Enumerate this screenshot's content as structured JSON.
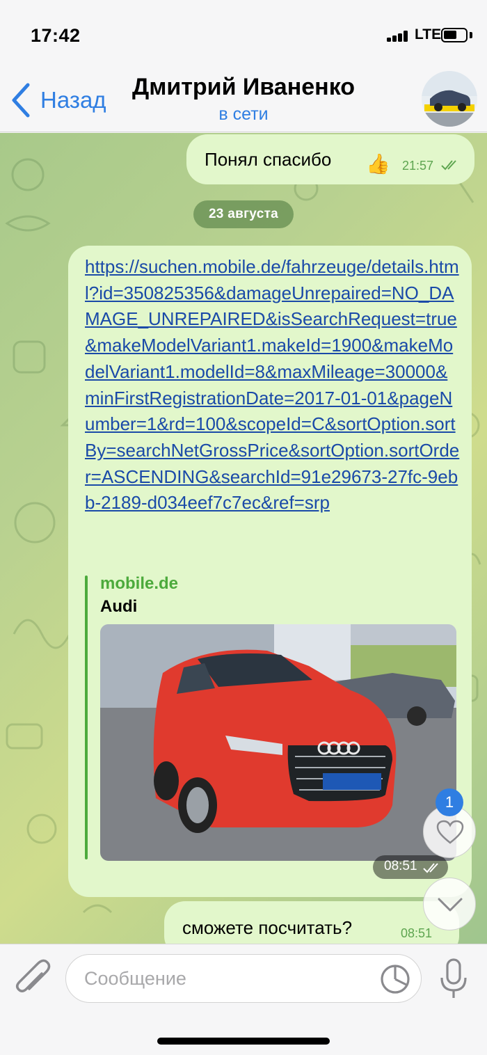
{
  "status_bar": {
    "time": "17:42",
    "network": "LTE",
    "icons": [
      "signal-icon",
      "battery-icon"
    ]
  },
  "header": {
    "back_label": "Назад",
    "contact_name": "Дмитрий Иваненко",
    "contact_status": "в сети",
    "accent_color": "#2f7ee2"
  },
  "messages": [
    {
      "direction": "outgoing",
      "text": "Понял спасибо",
      "emoji": "👍",
      "time": "21:57",
      "status": "read"
    },
    {
      "type": "date_separator",
      "text": "23 августа"
    },
    {
      "direction": "incoming",
      "link": "https://suchen.mobile.de/fahrzeuge/details.html?id=350825356&damageUnrepaired=NO_DAMAGE_UNREPAIRED&isSearchRequest=true&makeModelVariant1.makeId=1900&makeModelVariant1.modelId=8&maxMileage=30000&minFirstRegistrationDate=2017-01-01&pageNumber=1&rd=100&scopeId=C&sortOption.sortBy=searchNetGrossPrice&sortOption.sortOrder=ASCENDING&searchId=91e29673-27fc-9ebb-2189-d034eef7c7ec&ref=srp",
      "preview_site": "mobile.de",
      "preview_title": "Audi",
      "time": "08:51",
      "status": "read"
    },
    {
      "direction": "outgoing",
      "text": "сможете посчитать?",
      "time": "08:51",
      "status": "read"
    }
  ],
  "floating": {
    "like_badge": "1"
  },
  "input": {
    "placeholder": "Сообщение",
    "value": ""
  },
  "colors": {
    "bubble_out": "#e2f7cb",
    "time_green": "#5ea550",
    "link_blue": "#1a4aa8",
    "preview_green": "#4caa3c"
  }
}
